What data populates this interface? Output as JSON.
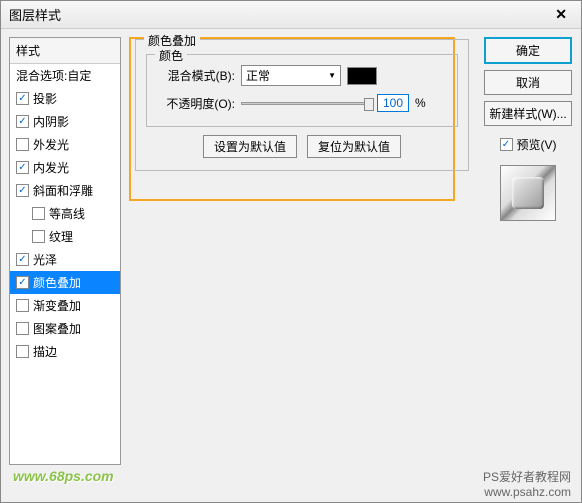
{
  "dialog": {
    "title": "图层样式"
  },
  "sidebar": {
    "header": "样式",
    "blend_header": "混合选项:自定",
    "items": [
      {
        "label": "投影",
        "checked": true,
        "selected": false,
        "indent": false
      },
      {
        "label": "内阴影",
        "checked": true,
        "selected": false,
        "indent": false
      },
      {
        "label": "外发光",
        "checked": false,
        "selected": false,
        "indent": false
      },
      {
        "label": "内发光",
        "checked": true,
        "selected": false,
        "indent": false
      },
      {
        "label": "斜面和浮雕",
        "checked": true,
        "selected": false,
        "indent": false
      },
      {
        "label": "等高线",
        "checked": false,
        "selected": false,
        "indent": true
      },
      {
        "label": "纹理",
        "checked": false,
        "selected": false,
        "indent": true
      },
      {
        "label": "光泽",
        "checked": true,
        "selected": false,
        "indent": false
      },
      {
        "label": "颜色叠加",
        "checked": true,
        "selected": true,
        "indent": false
      },
      {
        "label": "渐变叠加",
        "checked": false,
        "selected": false,
        "indent": false
      },
      {
        "label": "图案叠加",
        "checked": false,
        "selected": false,
        "indent": false
      },
      {
        "label": "描边",
        "checked": false,
        "selected": false,
        "indent": false
      }
    ]
  },
  "main": {
    "group_title": "颜色叠加",
    "color_group": "颜色",
    "blend_mode_label": "混合模式(B):",
    "blend_mode_value": "正常",
    "opacity_label": "不透明度(O):",
    "opacity_value": "100",
    "opacity_unit": "%",
    "set_default": "设置为默认值",
    "reset_default": "复位为默认值"
  },
  "actions": {
    "ok": "确定",
    "cancel": "取消",
    "new_style": "新建样式(W)...",
    "preview_label": "预览(V)"
  },
  "footer": {
    "left": "www.68ps.com",
    "right_line1": "PS爱好者教程网",
    "right_line2": "www.psahz.com"
  }
}
